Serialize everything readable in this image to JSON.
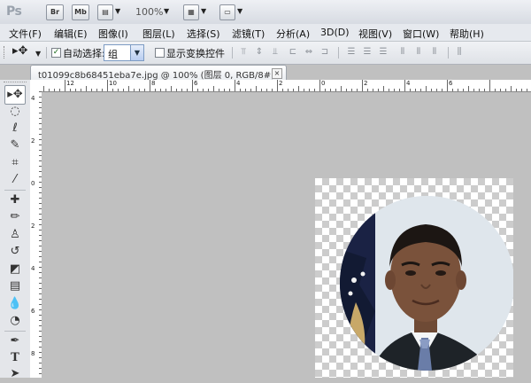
{
  "app": {
    "logo": "Ps",
    "bridge_label": "Br",
    "minibridge_label": "Mb",
    "zoom": "100%"
  },
  "menu": [
    "文件(F)",
    "编辑(E)",
    "图像(I)",
    "图层(L)",
    "选择(S)",
    "滤镜(T)",
    "分析(A)",
    "3D(D)",
    "视图(V)",
    "窗口(W)",
    "帮助(H)"
  ],
  "options": {
    "auto_select_label": "自动选择:",
    "auto_select_checked": true,
    "group_value": "组",
    "show_transform_label": "显示变换控件",
    "show_transform_checked": false
  },
  "document": {
    "tab_title": "t01099c8b68451eba7e.jpg @ 100% (图层 0, RGB/8#) *",
    "close_label": "×"
  },
  "ruler": {
    "top": [
      "12",
      "10",
      "8",
      "6",
      "4",
      "2",
      "0",
      "2",
      "4",
      "6"
    ],
    "left": [
      "4",
      "2",
      "0",
      "2",
      "4",
      "6",
      "8",
      "0"
    ]
  },
  "colors": {
    "canvas_gray": "#c0c0c0",
    "checker": "#cccccc",
    "accent": "#7d9bc3"
  },
  "icons": [
    "move-tool-icon",
    "marquee-tool-icon",
    "lasso-tool-icon",
    "quick-select-tool-icon",
    "crop-tool-icon",
    "eyedropper-tool-icon",
    "healing-brush-icon",
    "brush-tool-icon",
    "clone-stamp-icon",
    "history-brush-icon",
    "eraser-tool-icon",
    "gradient-tool-icon",
    "blur-tool-icon",
    "dodge-tool-icon",
    "pen-tool-icon",
    "type-tool-icon",
    "path-select-icon"
  ]
}
